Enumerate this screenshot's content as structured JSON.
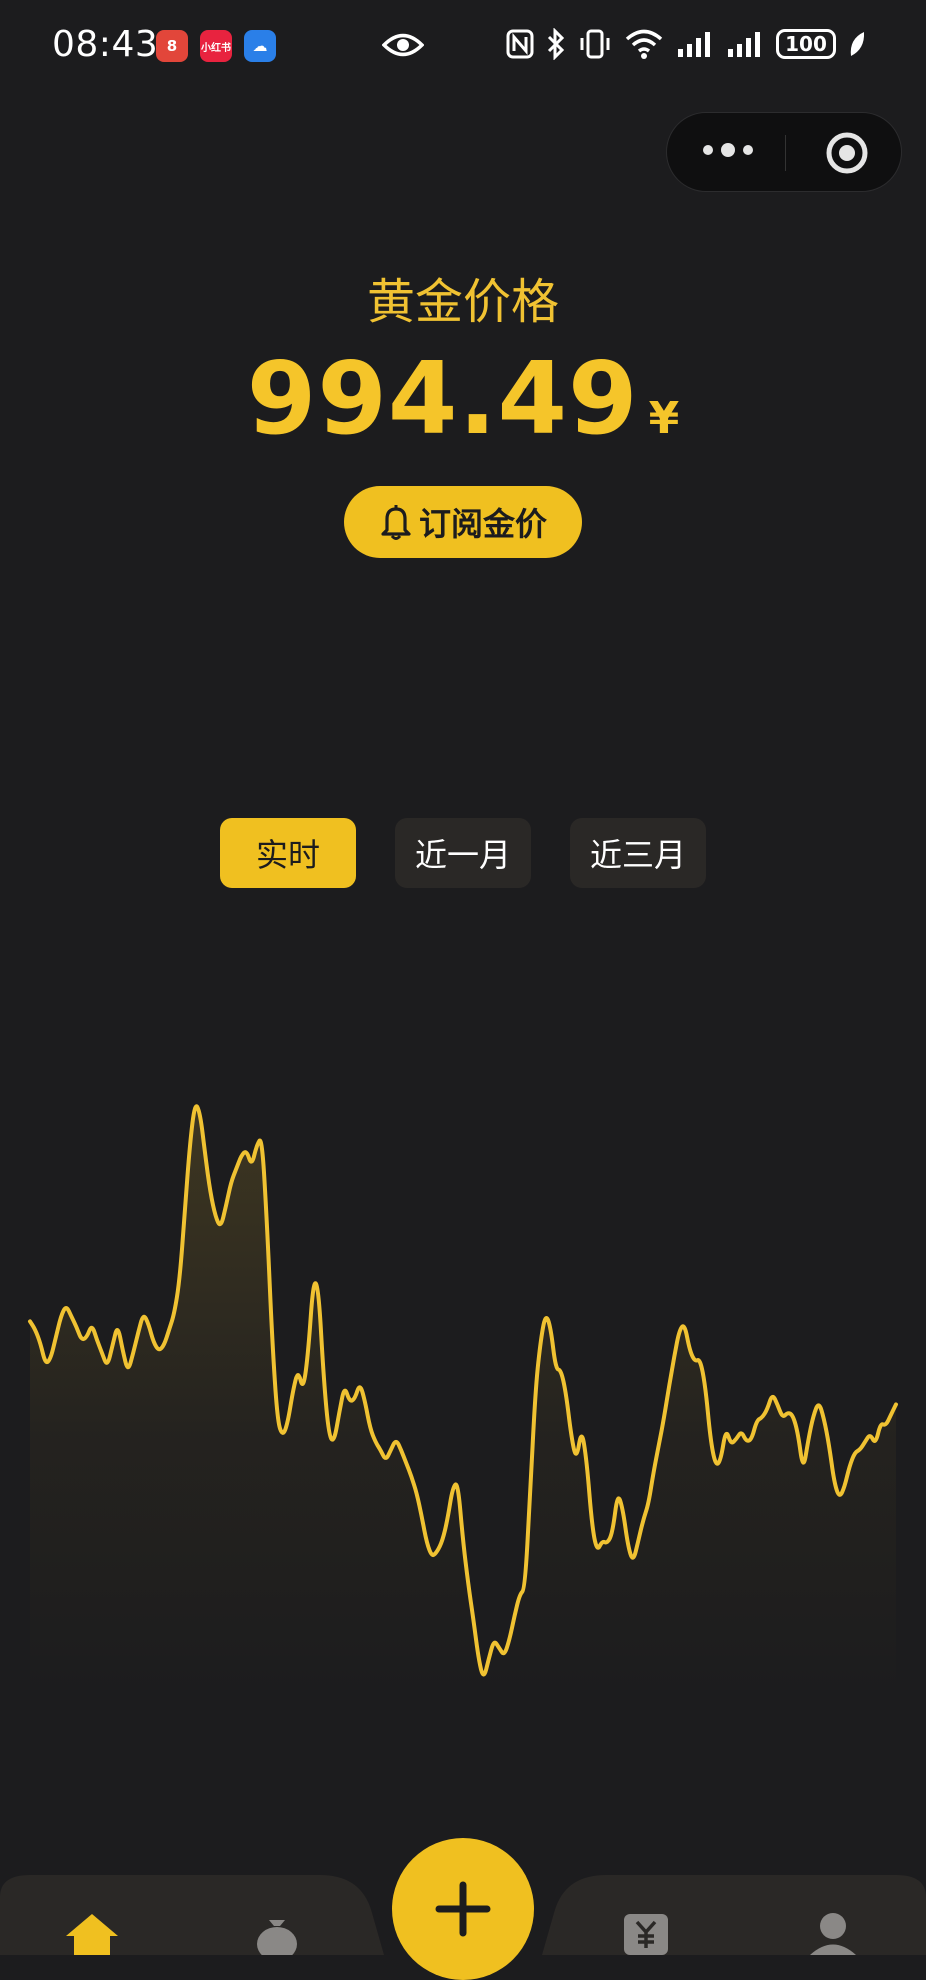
{
  "status_bar": {
    "time": "08:43",
    "battery": "100",
    "app_badges": [
      {
        "name": "red-app-badge",
        "color": "#e2463a",
        "text": "8"
      },
      {
        "name": "xiaohongshu-badge",
        "color": "#e8233f",
        "text": "小红书"
      },
      {
        "name": "weather-badge",
        "color": "#2a7fe8",
        "text": "☁"
      }
    ]
  },
  "header": {
    "title": "黄金价格",
    "price": "994.49",
    "currency": "¥",
    "subscribe_label": "订阅金价"
  },
  "tabs": [
    {
      "label": "实时",
      "active": true
    },
    {
      "label": "近一月",
      "active": false
    },
    {
      "label": "近三月",
      "active": false
    }
  ],
  "colors": {
    "accent": "#f0c020",
    "background": "#1c1c1e",
    "line": "#f0c232"
  },
  "chart_data": {
    "type": "line",
    "values": [
      5.0,
      4.7,
      4.2,
      3.4,
      3.6,
      4.4,
      5.2,
      5.6,
      5.2,
      4.8,
      4.3,
      4.4,
      4.9,
      4.3,
      3.8,
      3.3,
      4.1,
      4.9,
      3.9,
      3.1,
      3.8,
      4.6,
      5.3,
      4.9,
      4.2,
      3.9,
      4.1,
      4.7,
      5.3,
      6.5,
      9.0,
      11.6,
      13.2,
      12.8,
      11.2,
      9.8,
      8.9,
      8.5,
      9.3,
      10.2,
      10.7,
      11.2,
      11.4,
      10.8,
      11.6,
      11.9,
      8.6,
      4.2,
      1.3,
      0.7,
      1.2,
      2.4,
      3.2,
      2.4,
      3.9,
      6.6,
      6.2,
      2.8,
      0.7,
      0.5,
      1.6,
      2.6,
      2.0,
      2.1,
      2.7,
      2.0,
      1.0,
      0.5,
      0.2,
      -0.2,
      0.2,
      0.6,
      0.2,
      -0.3,
      -0.8,
      -1.4,
      -2.3,
      -3.3,
      -3.8,
      -3.6,
      -3.2,
      -2.4,
      -1.2,
      -1.0,
      -3.2,
      -4.8,
      -6.1,
      -7.6,
      -8.4,
      -7.6,
      -6.9,
      -7.2,
      -7.5,
      -6.9,
      -6.0,
      -5.2,
      -5.0,
      -1.6,
      2.3,
      4.2,
      5.3,
      4.8,
      3.2,
      3.2,
      2.3,
      0.7,
      -0.2,
      1.0,
      -0.2,
      -2.6,
      -3.6,
      -3.2,
      -3.3,
      -2.9,
      -1.4,
      -2.0,
      -3.4,
      -4.0,
      -3.2,
      -2.4,
      -1.8,
      -0.6,
      0.4,
      1.4,
      2.6,
      3.7,
      4.7,
      4.9,
      3.9,
      3.5,
      3.6,
      2.6,
      0.6,
      -0.4,
      -0.2,
      1.0,
      0.4,
      0.6,
      0.9,
      0.5,
      0.6,
      1.3,
      1.4,
      1.7,
      2.3,
      1.9,
      1.4,
      1.6,
      1.5,
      0.8,
      -0.6,
      0.6,
      1.5,
      2.0,
      1.4,
      0.4,
      -1.0,
      -1.6,
      -1.2,
      -0.4,
      0.1,
      0.2,
      0.5,
      0.8,
      0.4,
      1.2,
      1.1,
      1.5,
      1.9
    ]
  },
  "nav": {
    "fab_label": "+"
  }
}
